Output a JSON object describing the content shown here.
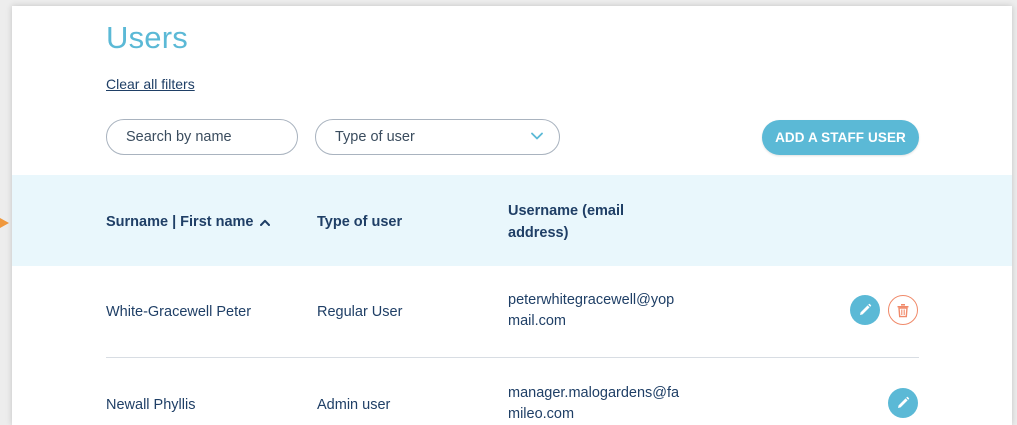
{
  "page": {
    "title": "Users",
    "clear_filters_label": "Clear all filters"
  },
  "filters": {
    "search_label": "Search by name",
    "type_label": "Type of user"
  },
  "actions": {
    "add_staff_label": "ADD A STAFF USER"
  },
  "table": {
    "headers": {
      "name": "Surname | First name",
      "type": "Type of user",
      "username": "Username (email address)"
    },
    "rows": [
      {
        "name": "White-Gracewell Peter",
        "type": "Regular User",
        "email": "peterwhitegracewell@yopmail.com",
        "actions": [
          "pencil-icon",
          "trash-icon"
        ]
      },
      {
        "name": "Newall Phyllis",
        "type": "Admin user",
        "email": "manager.malogardens@fa mileo.com",
        "actions": [
          "pencil-icon"
        ]
      }
    ]
  },
  "colors": {
    "accent": "#5bb9d6",
    "text": "#1f3f66",
    "header_band": "#e9f7fc",
    "delete": "#f08a6a",
    "marker": "#f0983d"
  }
}
